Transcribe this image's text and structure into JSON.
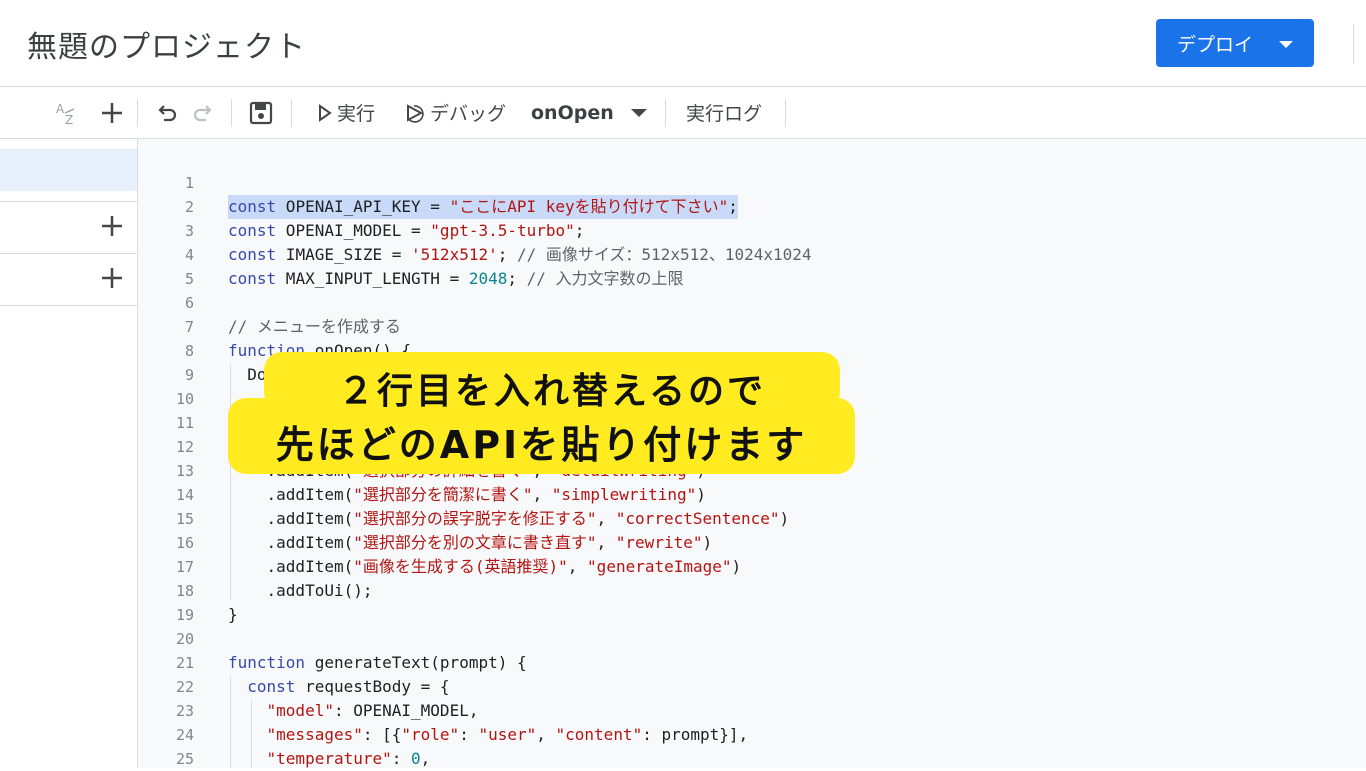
{
  "header": {
    "title": "無題のプロジェクト",
    "deploy_label": "デプロイ"
  },
  "toolbar": {
    "run_label": "実行",
    "debug_label": "デバッグ",
    "function_select": "onOpen",
    "log_label": "実行ログ"
  },
  "editor": {
    "lines": [
      {
        "n": "1",
        "t": ""
      },
      {
        "n": "2",
        "t": "const OPENAI_API_KEY = \"ここにAPI keyを貼り付けて下さい\";"
      },
      {
        "n": "3",
        "t": "const OPENAI_MODEL = \"gpt-3.5-turbo\";"
      },
      {
        "n": "4",
        "t": "const IMAGE_SIZE = '512x512'; // 画像サイズ：512x512、1024x1024"
      },
      {
        "n": "5",
        "t": "const MAX_INPUT_LENGTH = 2048; // 入力文字数の上限"
      },
      {
        "n": "6",
        "t": ""
      },
      {
        "n": "7",
        "t": "// メニューを作成する"
      },
      {
        "n": "8",
        "t": "function onOpen() {"
      },
      {
        "n": "9",
        "t": "  Doc"
      },
      {
        "n": "10",
        "t": ""
      },
      {
        "n": "11",
        "t": ""
      },
      {
        "n": "12",
        "t": ""
      },
      {
        "n": "13",
        "t": "    .addItem(\"選択部分の詳細を書く\", \"detailWriting\")"
      },
      {
        "n": "14",
        "t": "    .addItem(\"選択部分を簡潔に書く\", \"simplewriting\")"
      },
      {
        "n": "15",
        "t": "    .addItem(\"選択部分の誤字脱字を修正する\", \"correctSentence\")"
      },
      {
        "n": "16",
        "t": "    .addItem(\"選択部分を別の文章に書き直す\", \"rewrite\")"
      },
      {
        "n": "17",
        "t": "    .addItem(\"画像を生成する(英語推奨)\", \"generateImage\")"
      },
      {
        "n": "18",
        "t": "    .addToUi();"
      },
      {
        "n": "19",
        "t": "}"
      },
      {
        "n": "20",
        "t": ""
      },
      {
        "n": "21",
        "t": "function generateText(prompt) {"
      },
      {
        "n": "22",
        "t": "  const requestBody = {"
      },
      {
        "n": "23",
        "t": "    \"model\": OPENAI_MODEL,"
      },
      {
        "n": "24",
        "t": "    \"messages\": [{\"role\": \"user\", \"content\": prompt}],"
      },
      {
        "n": "25",
        "t": "    \"temperature\": 0,"
      }
    ]
  },
  "overlay": {
    "line1": "２行目を入れ替えるので",
    "line2": "先ほどのAPIを貼り付けます"
  },
  "colors": {
    "accent": "#1a73e8",
    "banner": "#ffeb1f",
    "selection": "#c8daf8"
  }
}
